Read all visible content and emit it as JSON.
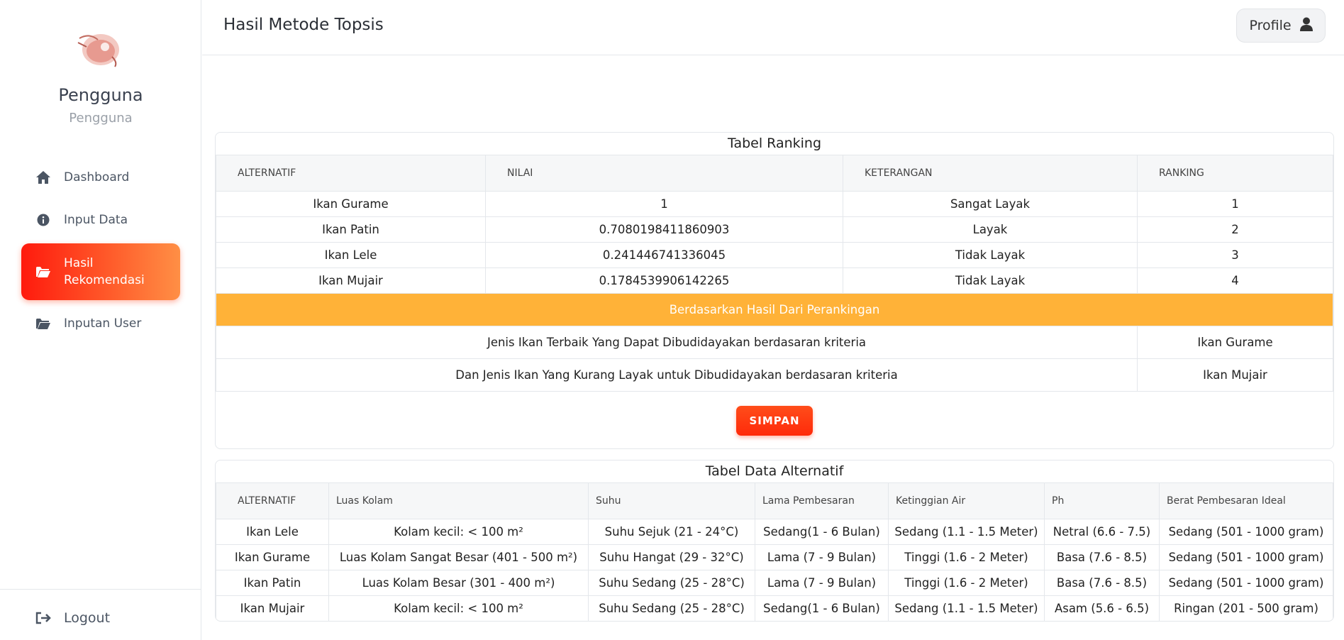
{
  "page": {
    "title": "Hasil Metode Topsis"
  },
  "profile": {
    "label": "Profile"
  },
  "user": {
    "name": "Pengguna",
    "role": "Pengguna"
  },
  "nav": {
    "items": [
      {
        "label": "Dashboard",
        "icon": "home-icon"
      },
      {
        "label": "Input Data",
        "icon": "info-circle-icon"
      },
      {
        "label": "Hasil Rekomendasi",
        "icon": "folder-open-icon"
      },
      {
        "label": "Inputan User",
        "icon": "folder-open-icon"
      }
    ],
    "logout": "Logout"
  },
  "ranking": {
    "title": "Tabel Ranking",
    "headers": [
      "ALTERNATIF",
      "NILAI",
      "KETERANGAN",
      "RANKING"
    ],
    "rows": [
      [
        "Ikan Gurame",
        "1",
        "Sangat Layak",
        "1"
      ],
      [
        "Ikan Patin",
        "0.7080198411860903",
        "Layak",
        "2"
      ],
      [
        "Ikan Lele",
        "0.241446741336045",
        "Tidak Layak",
        "3"
      ],
      [
        "Ikan Mujair",
        "0.1784539906142265",
        "Tidak Layak",
        "4"
      ]
    ],
    "banner": "Berdasarkan Hasil Dari Perankingan",
    "best_label": "Jenis Ikan Terbaik Yang Dapat Dibudidayakan berdasaran kriteria",
    "best_value": "Ikan Gurame",
    "worst_label": "Dan Jenis Ikan Yang Kurang Layak untuk Dibudidayakan berdasaran kriteria",
    "worst_value": "Ikan Mujair",
    "save_label": "SIMPAN"
  },
  "alternatif": {
    "title": "Tabel Data Alternatif",
    "headers": [
      "ALTERNATIF",
      "Luas Kolam",
      "Suhu",
      "Lama Pembesaran",
      "Ketinggian Air",
      "Ph",
      "Berat Pembesaran Ideal"
    ],
    "rows": [
      [
        "Ikan Lele",
        "Kolam kecil: < 100 m²",
        "Suhu Sejuk (21 - 24°C)",
        "Sedang(1 - 6 Bulan)",
        "Sedang (1.1 - 1.5 Meter)",
        "Netral (6.6 - 7.5)",
        "Sedang (501 - 1000 gram)"
      ],
      [
        "Ikan Gurame",
        "Luas Kolam Sangat Besar (401 - 500 m²)",
        "Suhu Hangat (29 - 32°C)",
        "Lama (7 - 9 Bulan)",
        "Tinggi (1.6 - 2 Meter)",
        "Basa (7.6 - 8.5)",
        "Sedang (501 - 1000 gram)"
      ],
      [
        "Ikan Patin",
        "Luas Kolam Besar (301 - 400 m²)",
        "Suhu Sedang (25 - 28°C)",
        "Lama (7 - 9 Bulan)",
        "Tinggi (1.6 - 2 Meter)",
        "Basa (7.6 - 8.5)",
        "Sedang (501 - 1000 gram)"
      ],
      [
        "Ikan Mujair",
        "Kolam kecil: < 100 m²",
        "Suhu Sedang (25 - 28°C)",
        "Sedang(1 - 6 Bulan)",
        "Sedang (1.1 - 1.5 Meter)",
        "Asam (5.6 - 6.5)",
        "Ringan (201 - 500 gram)"
      ]
    ]
  },
  "colors": {
    "accent": "#ff2a0a",
    "banner": "#ffb238"
  }
}
